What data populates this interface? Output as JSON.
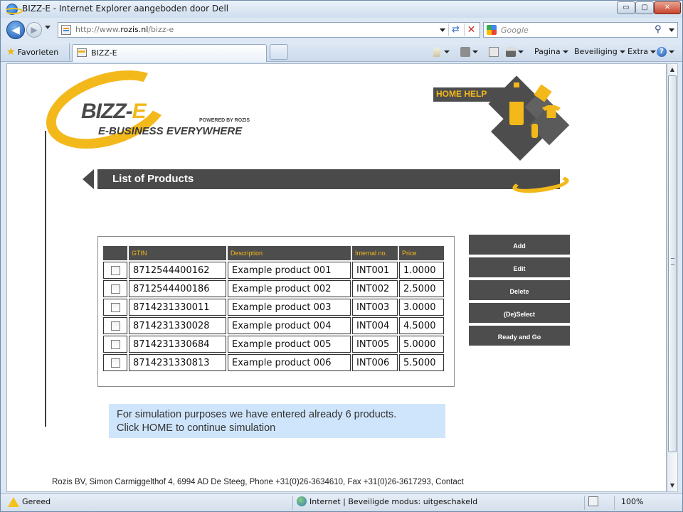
{
  "window": {
    "title": "BIZZ-E - Internet Explorer aangeboden door Dell",
    "min_glyph": "▭",
    "max_glyph": "▢",
    "close_glyph": "✕"
  },
  "address": {
    "url_prefix": "http://www.",
    "url_domain": "rozis.nl",
    "url_path": "/bizz-e",
    "search_placeholder": "Google"
  },
  "tabs": {
    "favorites_label": "Favorieten",
    "active_tab_label": "BIZZ-E"
  },
  "commands": {
    "page": "Pagina",
    "security": "Beveiliging",
    "extra": "Extra"
  },
  "logo": {
    "main_a": "BIZZ-",
    "main_b": "E",
    "tagline": "E-BUSINESS EVERYWHERE",
    "powered": "POWERED BY ROZIS"
  },
  "home_help": "HOME HELP",
  "heading": "List of Products",
  "table": {
    "columns": [
      "GTIN",
      "Description",
      "Internal no.",
      "Price"
    ],
    "rows": [
      {
        "gtin": "8712544400162",
        "description": "Example product 001",
        "internal_no": "INT001",
        "price": "1.0000"
      },
      {
        "gtin": "8712544400186",
        "description": "Example product 002",
        "internal_no": "INT002",
        "price": "2.5000"
      },
      {
        "gtin": "8714231330011",
        "description": "Example product 003",
        "internal_no": "INT003",
        "price": "3.0000"
      },
      {
        "gtin": "8714231330028",
        "description": "Example product 004",
        "internal_no": "INT004",
        "price": "4.5000"
      },
      {
        "gtin": "8714231330684",
        "description": "Example product 005",
        "internal_no": "INT005",
        "price": "5.0000"
      },
      {
        "gtin": "8714231330813",
        "description": "Example product 006",
        "internal_no": "INT006",
        "price": "5.5000"
      }
    ]
  },
  "actions": [
    "Add",
    "Edit",
    "Delete",
    "(De)Select",
    "Ready and Go"
  ],
  "info": {
    "line1": "For simulation purposes we have entered already 6 products.",
    "line2": "Click HOME to continue simulation"
  },
  "footer": "Rozis BV, Simon Carmiggelthof 4, 6994 AD De Steeg, Phone +31(0)26-3634610, Fax +31(0)26-3617293, Contact",
  "status": {
    "left": "Gereed",
    "zone": "Internet | Beveiligde modus: uitgeschakeld",
    "zoom": "100%"
  },
  "colors": {
    "brand_yellow": "#f3b81a",
    "brand_dark": "#4d4d4d",
    "info_bg": "#cfe5fb"
  }
}
